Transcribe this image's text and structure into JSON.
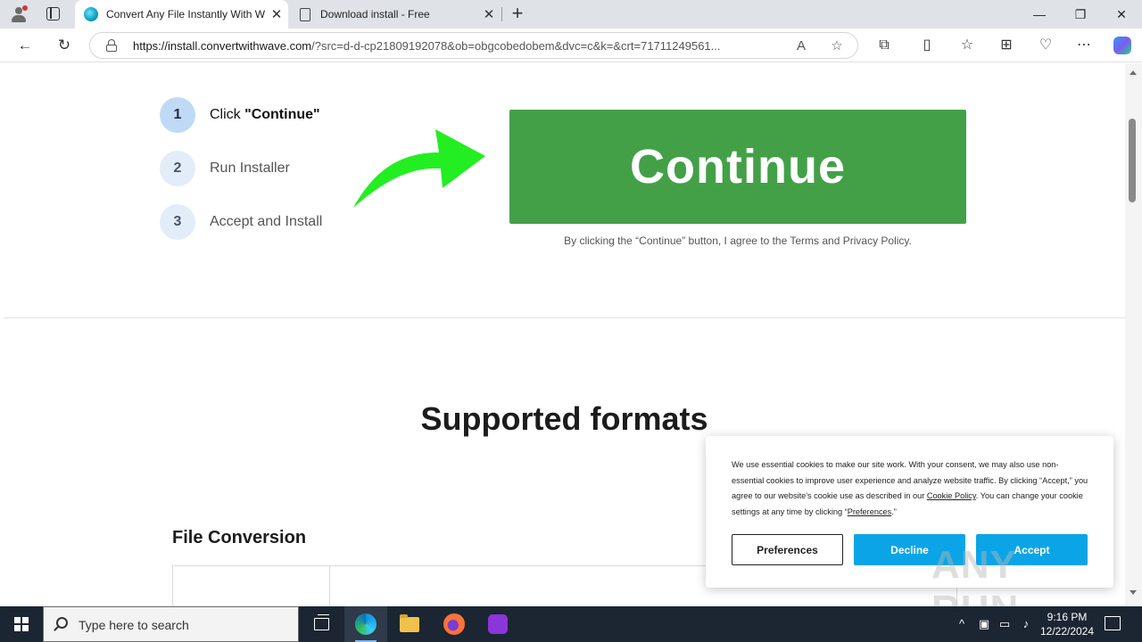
{
  "browser": {
    "tabs": [
      {
        "title": "Convert Any File Instantly With W",
        "active": true,
        "favicon": "wave-favicon"
      },
      {
        "title": "Download install - Free",
        "active": false,
        "favicon": "document-favicon"
      }
    ],
    "url_host": "https://install.convertwithwave.com",
    "url_rest": "/?src=d-d-cp21809192078&ob=obgcobedobem&dvc=c&k=&crt=71711249561...",
    "window_controls": {
      "minimize": "—",
      "maximize": "❐",
      "close": "✕"
    }
  },
  "steps": [
    {
      "number": "1",
      "label_prefix": "Click ",
      "label_bold": "\"Continue\"",
      "active": true
    },
    {
      "number": "2",
      "label": "Run Installer",
      "active": false
    },
    {
      "number": "3",
      "label": "Accept and Install",
      "active": false
    }
  ],
  "continue_button": {
    "label": "Continue",
    "color": "#43a047"
  },
  "terms_text": "By clicking the “Continue” button, I agree to the Terms and Privacy Policy.",
  "supported_formats_title": "Supported formats",
  "file_conversion_title": "File Conversion",
  "cookie": {
    "text_1": "We use essential cookies to make our site work. With your consent, we may also use non-essential cookies to improve user experience and analyze website traffic. By clicking “Accept,” you agree to our website's cookie use as described in our ",
    "link_policy": "Cookie Policy",
    "text_2": ". You can change your cookie settings at any time by clicking “",
    "link_prefs": "Preferences",
    "text_3": ".”",
    "preferences_label": "Preferences",
    "decline_label": "Decline",
    "accept_label": "Accept",
    "button_color": "#0ba5e7"
  },
  "watermark": "ANY RUN",
  "taskbar": {
    "search_placeholder": "Type here to search",
    "time": "9:16 PM",
    "date": "12/22/2024"
  }
}
